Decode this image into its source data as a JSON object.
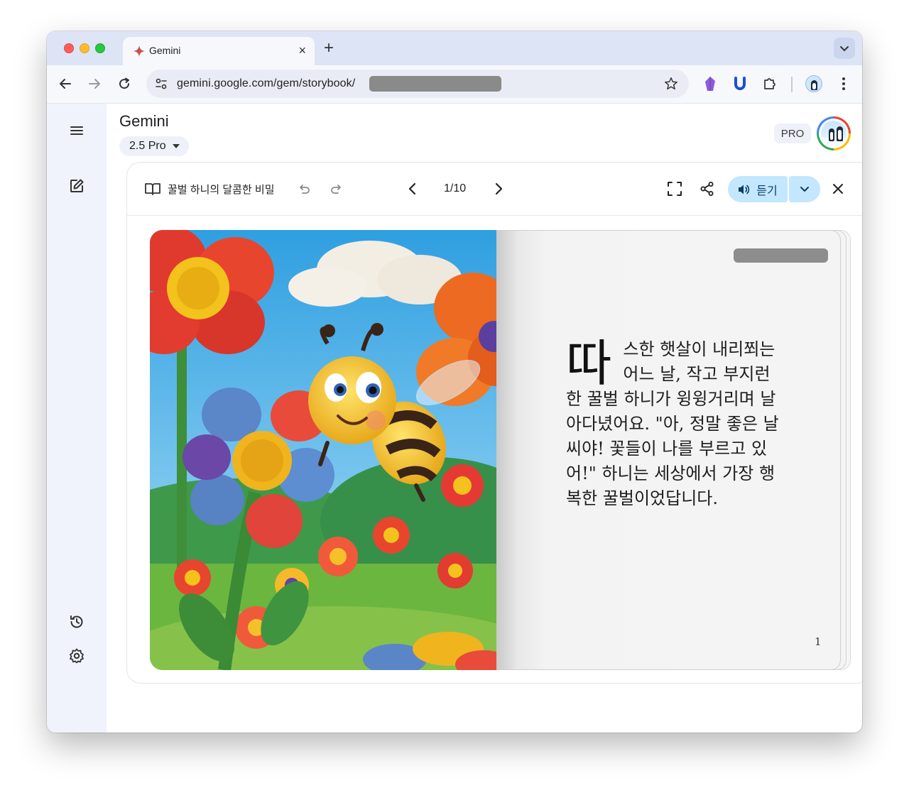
{
  "browser": {
    "tab_title": "Gemini",
    "new_tab_symbol": "+",
    "close_tab_symbol": "×",
    "url": "gemini.google.com/gem/storybook/"
  },
  "app": {
    "title": "Gemini",
    "model": "2.5 Pro",
    "pro_badge": "PRO"
  },
  "storybook": {
    "title": "꿀벌 하니의 달콤한 비밀",
    "page_indicator": "1/10",
    "listen_label": "듣기",
    "dropcap": "따",
    "story_text": "스한 햇살이 내리쬐는 어느 날, 작고 부지런한 꿀벌 하니가 윙윙거리며 날아다녔어요. \"아, 정말 좋은 날씨야! 꽃들이 나를 부르고 있어!\" 하니는 세상에서 가장 행복한 꿀벌이었답니다.",
    "page_number": "1"
  },
  "icons": {
    "rail": [
      "menu-icon",
      "new-chat-icon",
      "history-icon",
      "settings-icon"
    ],
    "toolbar": [
      "book-icon",
      "undo-icon",
      "redo-icon",
      "chevron-left-icon",
      "chevron-right-icon",
      "fullscreen-icon",
      "share-icon",
      "volume-icon",
      "chevron-down-icon",
      "close-icon"
    ]
  },
  "colors": {
    "listen_button": "#c2e7ff",
    "rail_background": "#f0f3fb",
    "tab_strip": "#dde4f6"
  }
}
